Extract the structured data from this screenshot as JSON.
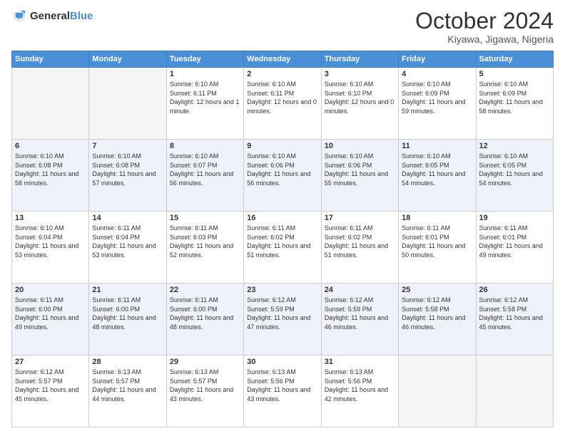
{
  "header": {
    "logo_general": "General",
    "logo_blue": "Blue",
    "month_title": "October 2024",
    "location": "Kiyawa, Jigawa, Nigeria"
  },
  "days_of_week": [
    "Sunday",
    "Monday",
    "Tuesday",
    "Wednesday",
    "Thursday",
    "Friday",
    "Saturday"
  ],
  "weeks": [
    [
      {
        "day": "",
        "info": ""
      },
      {
        "day": "",
        "info": ""
      },
      {
        "day": "1",
        "info": "Sunrise: 6:10 AM\nSunset: 6:11 PM\nDaylight: 12 hours and 1 minute."
      },
      {
        "day": "2",
        "info": "Sunrise: 6:10 AM\nSunset: 6:11 PM\nDaylight: 12 hours and 0 minutes."
      },
      {
        "day": "3",
        "info": "Sunrise: 6:10 AM\nSunset: 6:10 PM\nDaylight: 12 hours and 0 minutes."
      },
      {
        "day": "4",
        "info": "Sunrise: 6:10 AM\nSunset: 6:09 PM\nDaylight: 11 hours and 59 minutes."
      },
      {
        "day": "5",
        "info": "Sunrise: 6:10 AM\nSunset: 6:09 PM\nDaylight: 11 hours and 58 minutes."
      }
    ],
    [
      {
        "day": "6",
        "info": "Sunrise: 6:10 AM\nSunset: 6:08 PM\nDaylight: 11 hours and 58 minutes."
      },
      {
        "day": "7",
        "info": "Sunrise: 6:10 AM\nSunset: 6:08 PM\nDaylight: 11 hours and 57 minutes."
      },
      {
        "day": "8",
        "info": "Sunrise: 6:10 AM\nSunset: 6:07 PM\nDaylight: 11 hours and 56 minutes."
      },
      {
        "day": "9",
        "info": "Sunrise: 6:10 AM\nSunset: 6:06 PM\nDaylight: 11 hours and 56 minutes."
      },
      {
        "day": "10",
        "info": "Sunrise: 6:10 AM\nSunset: 6:06 PM\nDaylight: 11 hours and 55 minutes."
      },
      {
        "day": "11",
        "info": "Sunrise: 6:10 AM\nSunset: 6:05 PM\nDaylight: 11 hours and 54 minutes."
      },
      {
        "day": "12",
        "info": "Sunrise: 6:10 AM\nSunset: 6:05 PM\nDaylight: 11 hours and 54 minutes."
      }
    ],
    [
      {
        "day": "13",
        "info": "Sunrise: 6:10 AM\nSunset: 6:04 PM\nDaylight: 11 hours and 53 minutes."
      },
      {
        "day": "14",
        "info": "Sunrise: 6:11 AM\nSunset: 6:04 PM\nDaylight: 11 hours and 53 minutes."
      },
      {
        "day": "15",
        "info": "Sunrise: 6:11 AM\nSunset: 6:03 PM\nDaylight: 11 hours and 52 minutes."
      },
      {
        "day": "16",
        "info": "Sunrise: 6:11 AM\nSunset: 6:02 PM\nDaylight: 11 hours and 51 minutes."
      },
      {
        "day": "17",
        "info": "Sunrise: 6:11 AM\nSunset: 6:02 PM\nDaylight: 11 hours and 51 minutes."
      },
      {
        "day": "18",
        "info": "Sunrise: 6:11 AM\nSunset: 6:01 PM\nDaylight: 11 hours and 50 minutes."
      },
      {
        "day": "19",
        "info": "Sunrise: 6:11 AM\nSunset: 6:01 PM\nDaylight: 11 hours and 49 minutes."
      }
    ],
    [
      {
        "day": "20",
        "info": "Sunrise: 6:11 AM\nSunset: 6:00 PM\nDaylight: 11 hours and 49 minutes."
      },
      {
        "day": "21",
        "info": "Sunrise: 6:11 AM\nSunset: 6:00 PM\nDaylight: 11 hours and 48 minutes."
      },
      {
        "day": "22",
        "info": "Sunrise: 6:11 AM\nSunset: 6:00 PM\nDaylight: 11 hours and 48 minutes."
      },
      {
        "day": "23",
        "info": "Sunrise: 6:12 AM\nSunset: 5:59 PM\nDaylight: 11 hours and 47 minutes."
      },
      {
        "day": "24",
        "info": "Sunrise: 6:12 AM\nSunset: 5:59 PM\nDaylight: 11 hours and 46 minutes."
      },
      {
        "day": "25",
        "info": "Sunrise: 6:12 AM\nSunset: 5:58 PM\nDaylight: 11 hours and 46 minutes."
      },
      {
        "day": "26",
        "info": "Sunrise: 6:12 AM\nSunset: 5:58 PM\nDaylight: 11 hours and 45 minutes."
      }
    ],
    [
      {
        "day": "27",
        "info": "Sunrise: 6:12 AM\nSunset: 5:57 PM\nDaylight: 11 hours and 45 minutes."
      },
      {
        "day": "28",
        "info": "Sunrise: 6:13 AM\nSunset: 5:57 PM\nDaylight: 11 hours and 44 minutes."
      },
      {
        "day": "29",
        "info": "Sunrise: 6:13 AM\nSunset: 5:57 PM\nDaylight: 11 hours and 43 minutes."
      },
      {
        "day": "30",
        "info": "Sunrise: 6:13 AM\nSunset: 5:56 PM\nDaylight: 11 hours and 43 minutes."
      },
      {
        "day": "31",
        "info": "Sunrise: 6:13 AM\nSunset: 5:56 PM\nDaylight: 11 hours and 42 minutes."
      },
      {
        "day": "",
        "info": ""
      },
      {
        "day": "",
        "info": ""
      }
    ]
  ]
}
